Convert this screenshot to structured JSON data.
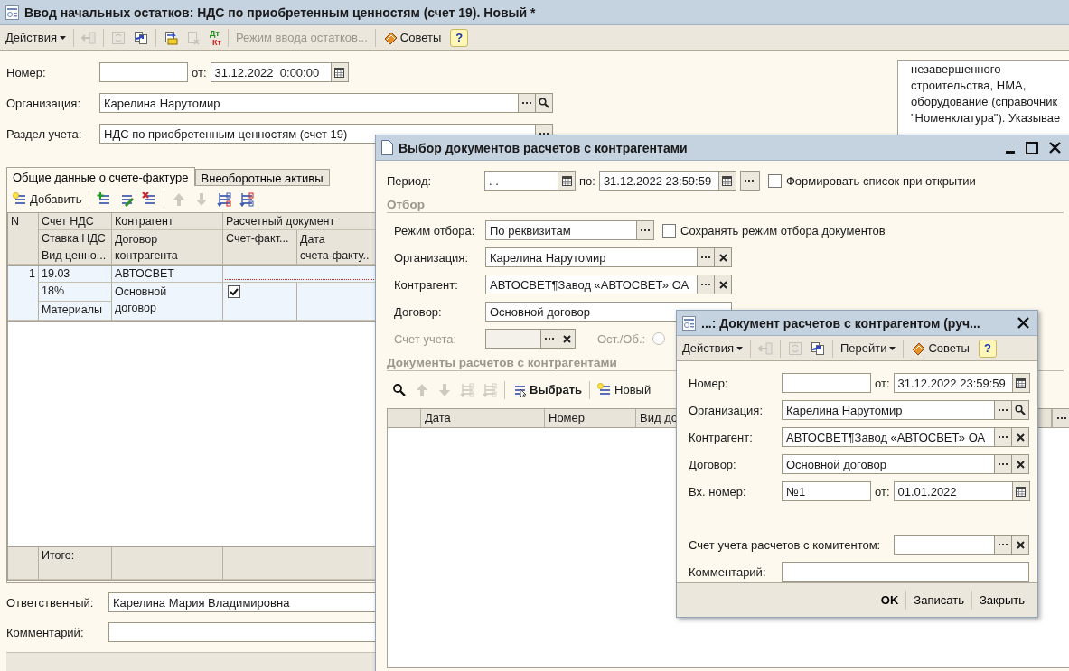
{
  "main": {
    "title": "Ввод начальных остатков: НДС по приобретенным ценностям (счет 19). Новый *",
    "toolbar": [
      {
        "kind": "menu",
        "label": "Действия",
        "disabled": false
      },
      {
        "kind": "sep"
      },
      {
        "kind": "back",
        "disabled": true
      },
      {
        "kind": "sep"
      },
      {
        "kind": "refresh",
        "disabled": true
      },
      {
        "kind": "copy",
        "disabled": false
      },
      {
        "kind": "sep"
      },
      {
        "kind": "post",
        "disabled": false
      },
      {
        "kind": "unpost",
        "disabled": true
      },
      {
        "kind": "ledger",
        "top": "Дт",
        "bottom": "Кт",
        "disabled": false
      },
      {
        "kind": "sep"
      },
      {
        "kind": "text",
        "label": "Режим ввода остатков...",
        "disabled": true
      },
      {
        "kind": "sep"
      },
      {
        "kind": "tips",
        "label": "Советы",
        "disabled": false
      },
      {
        "kind": "help",
        "label": "?",
        "disabled": false
      }
    ],
    "number": {
      "label": "Номер:",
      "date_label": "от:",
      "date": "31.12.2022  0:00:00"
    },
    "organization": {
      "label": "Организация:",
      "value": "Карелина Нарутомир",
      "buttons": [
        {
          "kind": "select"
        },
        {
          "kind": "search"
        }
      ]
    },
    "section": {
      "label": "Раздел учета:",
      "value": "НДС по приобретенным ценностям (счет 19)",
      "buttons": [
        {
          "kind": "select"
        }
      ]
    },
    "hint_lines": [
      "незавершенного",
      "строительства, НМА,",
      "оборудование (справочник",
      "\"Номенклатура\"). Указывае"
    ],
    "tabs": [
      {
        "label": "Общие данные о счете-фактуре",
        "selected": true
      },
      {
        "label": "Внеоборотные активы",
        "selected": false
      }
    ],
    "table_toolbar": [
      {
        "kind": "add",
        "label": "Добавить",
        "disabled": false
      },
      {
        "kind": "sep"
      },
      {
        "kind": "add_row",
        "disabled": false
      },
      {
        "kind": "edit_row",
        "disabled": false
      },
      {
        "kind": "delete_row",
        "disabled": false
      },
      {
        "kind": "sep"
      },
      {
        "kind": "up",
        "disabled": true
      },
      {
        "kind": "down",
        "disabled": true
      },
      {
        "kind": "sort_asc",
        "disabled": false
      },
      {
        "kind": "sort_desc",
        "disabled": false
      }
    ],
    "table": {
      "header": {
        "n": "N",
        "vat_account": "Счет НДС",
        "vat_rate": "Ставка НДС",
        "asset_type": "Вид ценно...",
        "counterparty": "Контрагент",
        "contract": [
          "Договор",
          "контрагента"
        ],
        "settlement_doc": "Расчетный документ",
        "invoice": "Счет-факт...",
        "invoice_date": [
          "Дата",
          "счета-факту.."
        ]
      },
      "rows": [
        {
          "n": "1",
          "vat_account": "19.03",
          "vat_rate": "18%",
          "asset_type": "Материалы",
          "counterparty": "АВТОСВЕТ",
          "contract": "Основной договор",
          "invoice_flag": true,
          "selected": true
        }
      ],
      "footer": "Итого:"
    },
    "responsible": {
      "label": "Ответственный:",
      "value": "Карелина Мария Владимировна"
    },
    "comment": {
      "label": "Комментарий:"
    }
  },
  "selection_dialog": {
    "title": "Выбор документов расчетов с контрагентами",
    "period": {
      "label": "Период:",
      "from": ". .",
      "to_label": "по:",
      "to": "31.12.2022 23:59:59"
    },
    "open_checkbox": {
      "label": "Формировать список при открытии",
      "checked": false
    },
    "filter_heading": "Отбор",
    "filter_mode": {
      "label": "Режим отбора:",
      "value": "По реквизитам",
      "buttons": [
        {
          "kind": "select"
        }
      ]
    },
    "save_mode_checkbox": {
      "label": "Сохранять режим отбора документов",
      "checked": false
    },
    "organization": {
      "label": "Организация:",
      "value": "Карелина Нарутомир",
      "buttons": [
        {
          "kind": "select"
        },
        {
          "kind": "clear"
        }
      ]
    },
    "counterparty": {
      "label": "Контрагент:",
      "value": "АВТОСВЕТ¶Завод «АВТОСВЕТ» ОА",
      "buttons": [
        {
          "kind": "select"
        },
        {
          "kind": "clear"
        }
      ]
    },
    "contract": {
      "label": "Договор:",
      "value": "Основной договор"
    },
    "account": {
      "label": "Счет учета:",
      "disabled": true,
      "buttons": [
        {
          "kind": "select"
        },
        {
          "kind": "clear"
        }
      ]
    },
    "turnover": {
      "label": "Ост./Об.:",
      "disabled": true,
      "selected": false
    },
    "docs_heading": "Документы расчетов с контрагентами",
    "toolbar": [
      {
        "kind": "search",
        "disabled": false
      },
      {
        "kind": "up",
        "disabled": true
      },
      {
        "kind": "down",
        "disabled": true
      },
      {
        "kind": "sort_asc",
        "disabled": true
      },
      {
        "kind": "sort_desc",
        "disabled": true
      },
      {
        "kind": "sep"
      },
      {
        "kind": "choose",
        "label": "Выбрать",
        "disabled": false
      },
      {
        "kind": "sep"
      },
      {
        "kind": "add",
        "label": "Новый",
        "disabled": false
      }
    ],
    "columns": [
      "Дата",
      "Номер",
      "Вид до"
    ]
  },
  "document_dialog": {
    "title": "...: Документ расчетов с контрагентом (руч...",
    "toolbar": [
      {
        "kind": "menu",
        "label": "Действия",
        "disabled": false
      },
      {
        "kind": "sep"
      },
      {
        "kind": "back",
        "disabled": true
      },
      {
        "kind": "sep"
      },
      {
        "kind": "refresh",
        "disabled": true
      },
      {
        "kind": "copy",
        "disabled": false
      },
      {
        "kind": "sep"
      },
      {
        "kind": "menu",
        "label": "Перейти",
        "disabled": false
      },
      {
        "kind": "sep"
      },
      {
        "kind": "tips",
        "label": "Советы",
        "disabled": false
      },
      {
        "kind": "help",
        "label": "?",
        "disabled": false
      }
    ],
    "number": {
      "label": "Номер:",
      "date_label": "от:",
      "date": "31.12.2022 23:59:59"
    },
    "organization": {
      "label": "Организация:",
      "value": "Карелина Нарутомир",
      "buttons": [
        {
          "kind": "select"
        },
        {
          "kind": "search"
        }
      ]
    },
    "counterparty": {
      "label": "Контрагент:",
      "value": "АВТОСВЕТ¶Завод «АВТОСВЕТ» ОА",
      "buttons": [
        {
          "kind": "select"
        },
        {
          "kind": "clear"
        }
      ]
    },
    "contract": {
      "label": "Договор:",
      "value": "Основной договор",
      "buttons": [
        {
          "kind": "select"
        },
        {
          "kind": "clear"
        }
      ]
    },
    "incoming": {
      "label": "Вх. номер:",
      "value": "№1",
      "date_label": "от:",
      "date": "01.01.2022"
    },
    "account": {
      "label": "Счет учета расчетов с комитентом:",
      "buttons": [
        {
          "kind": "select"
        },
        {
          "kind": "clear"
        }
      ]
    },
    "comment": {
      "label": "Комментарий:"
    },
    "buttons": {
      "ok": "OK",
      "save": "Записать",
      "close": "Закрыть"
    }
  }
}
